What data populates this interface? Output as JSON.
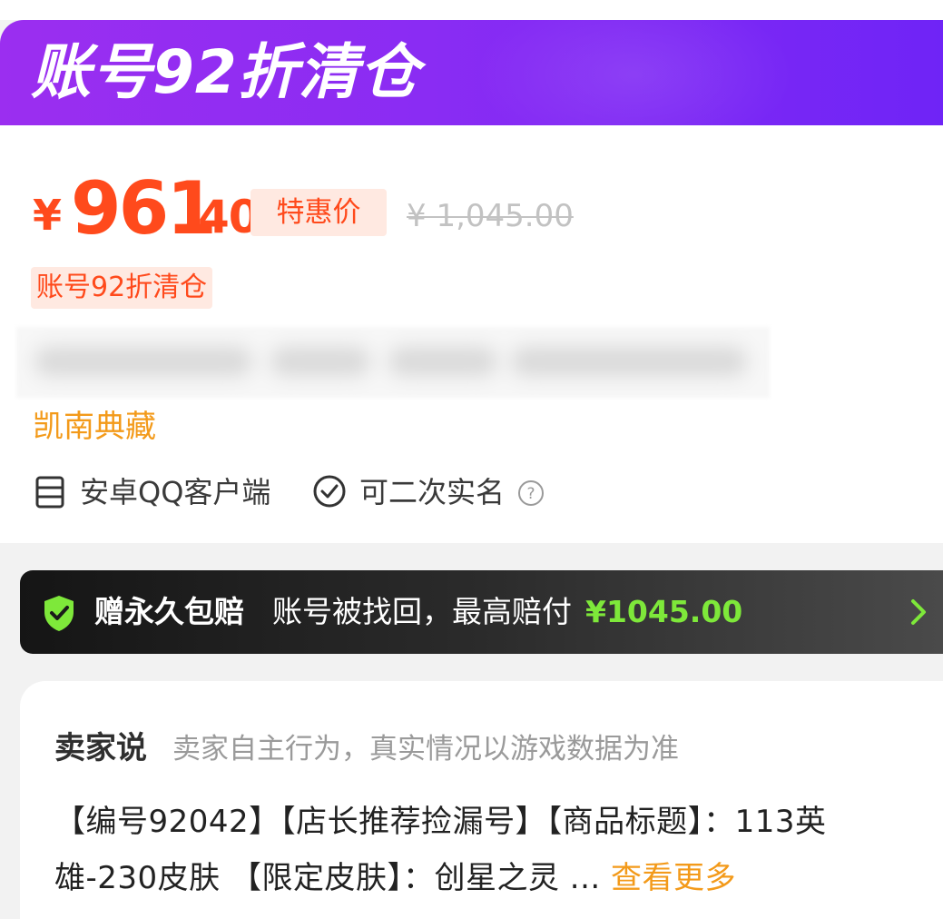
{
  "banner": {
    "title": "账号92折清仓",
    "gradient_start": "#9b2ef0",
    "gradient_end": "#6f24f6"
  },
  "price": {
    "currency": "¥",
    "integer": "961",
    "decimal": ".40",
    "special_label": "特惠价",
    "original": "¥ 1,045.00",
    "accent_color": "#ff4a1c"
  },
  "discount_tag": "账号92折清仓",
  "seller": {
    "name": "凯南典藏"
  },
  "attributes": {
    "client": {
      "icon": "device-icon",
      "label": "安卓QQ客户端"
    },
    "realname": {
      "icon": "check-circle-icon",
      "label": "可二次实名"
    },
    "help_icon": "help-icon"
  },
  "guarantee": {
    "icon": "shield-check-icon",
    "title": "赠永久包赔",
    "desc": "账号被找回，最高赔付",
    "amount": "¥1045.00",
    "amount_color": "#7ee83a"
  },
  "seller_says": {
    "title": "卖家说",
    "note": "卖家自主行为，真实情况以游戏数据为准",
    "desc": "【编号92042】【店长推荐捡漏号】【商品标题】：113英雄-230皮肤 【限定皮肤】：创星之灵 ... ",
    "more": "查看更多"
  }
}
